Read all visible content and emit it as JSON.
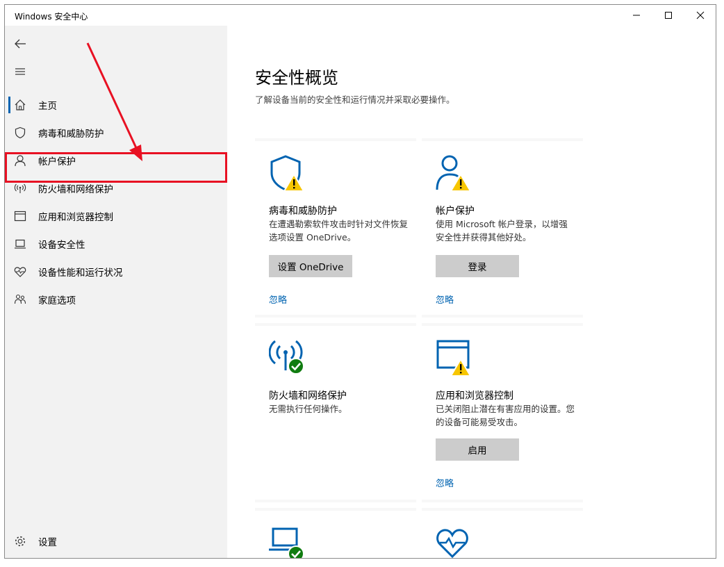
{
  "window": {
    "title": "Windows 安全中心"
  },
  "sidebar": {
    "items": [
      {
        "label": "主页",
        "icon": "home-icon"
      },
      {
        "label": "病毒和威胁防护",
        "icon": "shield-icon"
      },
      {
        "label": "帐户保护",
        "icon": "person-icon"
      },
      {
        "label": "防火墙和网络保护",
        "icon": "wifi-antenna-icon"
      },
      {
        "label": "应用和浏览器控制",
        "icon": "app-window-icon"
      },
      {
        "label": "设备安全性",
        "icon": "laptop-icon"
      },
      {
        "label": "设备性能和运行状况",
        "icon": "heart-pulse-icon"
      },
      {
        "label": "家庭选项",
        "icon": "family-icon"
      }
    ],
    "settings_label": "设置"
  },
  "main": {
    "title": "安全性概览",
    "subtitle": "了解设备当前的安全性和运行情况并采取必要操作。",
    "cards": [
      {
        "title": "病毒和威胁防护",
        "desc": "在遭遇勒索软件攻击时针对文件恢复选项设置 OneDrive。",
        "button": "设置 OneDrive",
        "link": "忽略",
        "status": "warning"
      },
      {
        "title": "帐户保护",
        "desc": "使用 Microsoft 帐户登录，以增强安全性并获得其他好处。",
        "button": "登录",
        "link": "忽略",
        "status": "warning"
      },
      {
        "title": "防火墙和网络保护",
        "desc": "无需执行任何操作。",
        "status": "ok"
      },
      {
        "title": "应用和浏览器控制",
        "desc": "已关闭阻止潜在有害应用的设置。您的设备可能易受攻击。",
        "button": "启用",
        "link": "忽略",
        "status": "warning"
      },
      {
        "status": "ok"
      },
      {
        "status": "ok"
      }
    ]
  },
  "colors": {
    "accent": "#0063b1",
    "warning": "#f7c600",
    "ok": "#107c10",
    "highlight": "#e81123"
  }
}
